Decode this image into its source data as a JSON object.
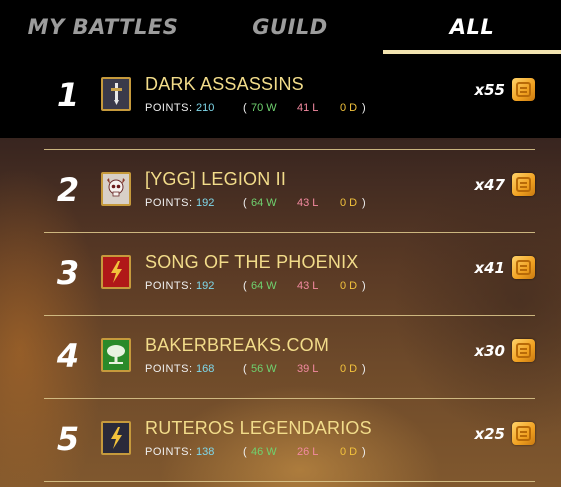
{
  "tabs": [
    {
      "label": "MY BATTLES",
      "active": false
    },
    {
      "label": "GUILD",
      "active": false
    },
    {
      "label": "ALL",
      "active": true
    }
  ],
  "stat_label": "POINTS:",
  "rows": [
    {
      "rank": "1",
      "name": "DARK ASSASSINS",
      "points": "210",
      "wins": "70 W",
      "losses": "41 L",
      "draws": "0 D",
      "multiplier": "x55",
      "emblem": "sword-banner-icon",
      "emblem_bg": "#3a3a4a"
    },
    {
      "rank": "2",
      "name": "[YGG] LEGION II",
      "points": "192",
      "wins": "64 W",
      "losses": "43 L",
      "draws": "0 D",
      "multiplier": "x47",
      "emblem": "skull-banner-icon",
      "emblem_bg": "#d8d0c8"
    },
    {
      "rank": "3",
      "name": "SONG OF THE PHOENIX",
      "points": "192",
      "wins": "64 W",
      "losses": "43 L",
      "draws": "0 D",
      "multiplier": "x41",
      "emblem": "lightning-banner-icon",
      "emblem_bg": "#b01818"
    },
    {
      "rank": "4",
      "name": "BAKERBREAKS.COM",
      "points": "168",
      "wins": "56 W",
      "losses": "39 L",
      "draws": "0 D",
      "multiplier": "x30",
      "emblem": "tree-banner-icon",
      "emblem_bg": "#2a8a2a"
    },
    {
      "rank": "5",
      "name": "RUTEROS LEGENDARIOS",
      "points": "138",
      "wins": "46 W",
      "losses": "26 L",
      "draws": "0 D",
      "multiplier": "x25",
      "emblem": "lightning-banner-icon",
      "emblem_bg": "#2a2a3a"
    }
  ],
  "colors": {
    "guild_name": "#f2dc8a",
    "points": "#7fd8ea",
    "wins": "#6fd26f",
    "losses": "#f38aa0",
    "draws": "#f2c23c",
    "tab_underline": "#f2e4b0"
  },
  "token_icon": "gold-token-icon"
}
